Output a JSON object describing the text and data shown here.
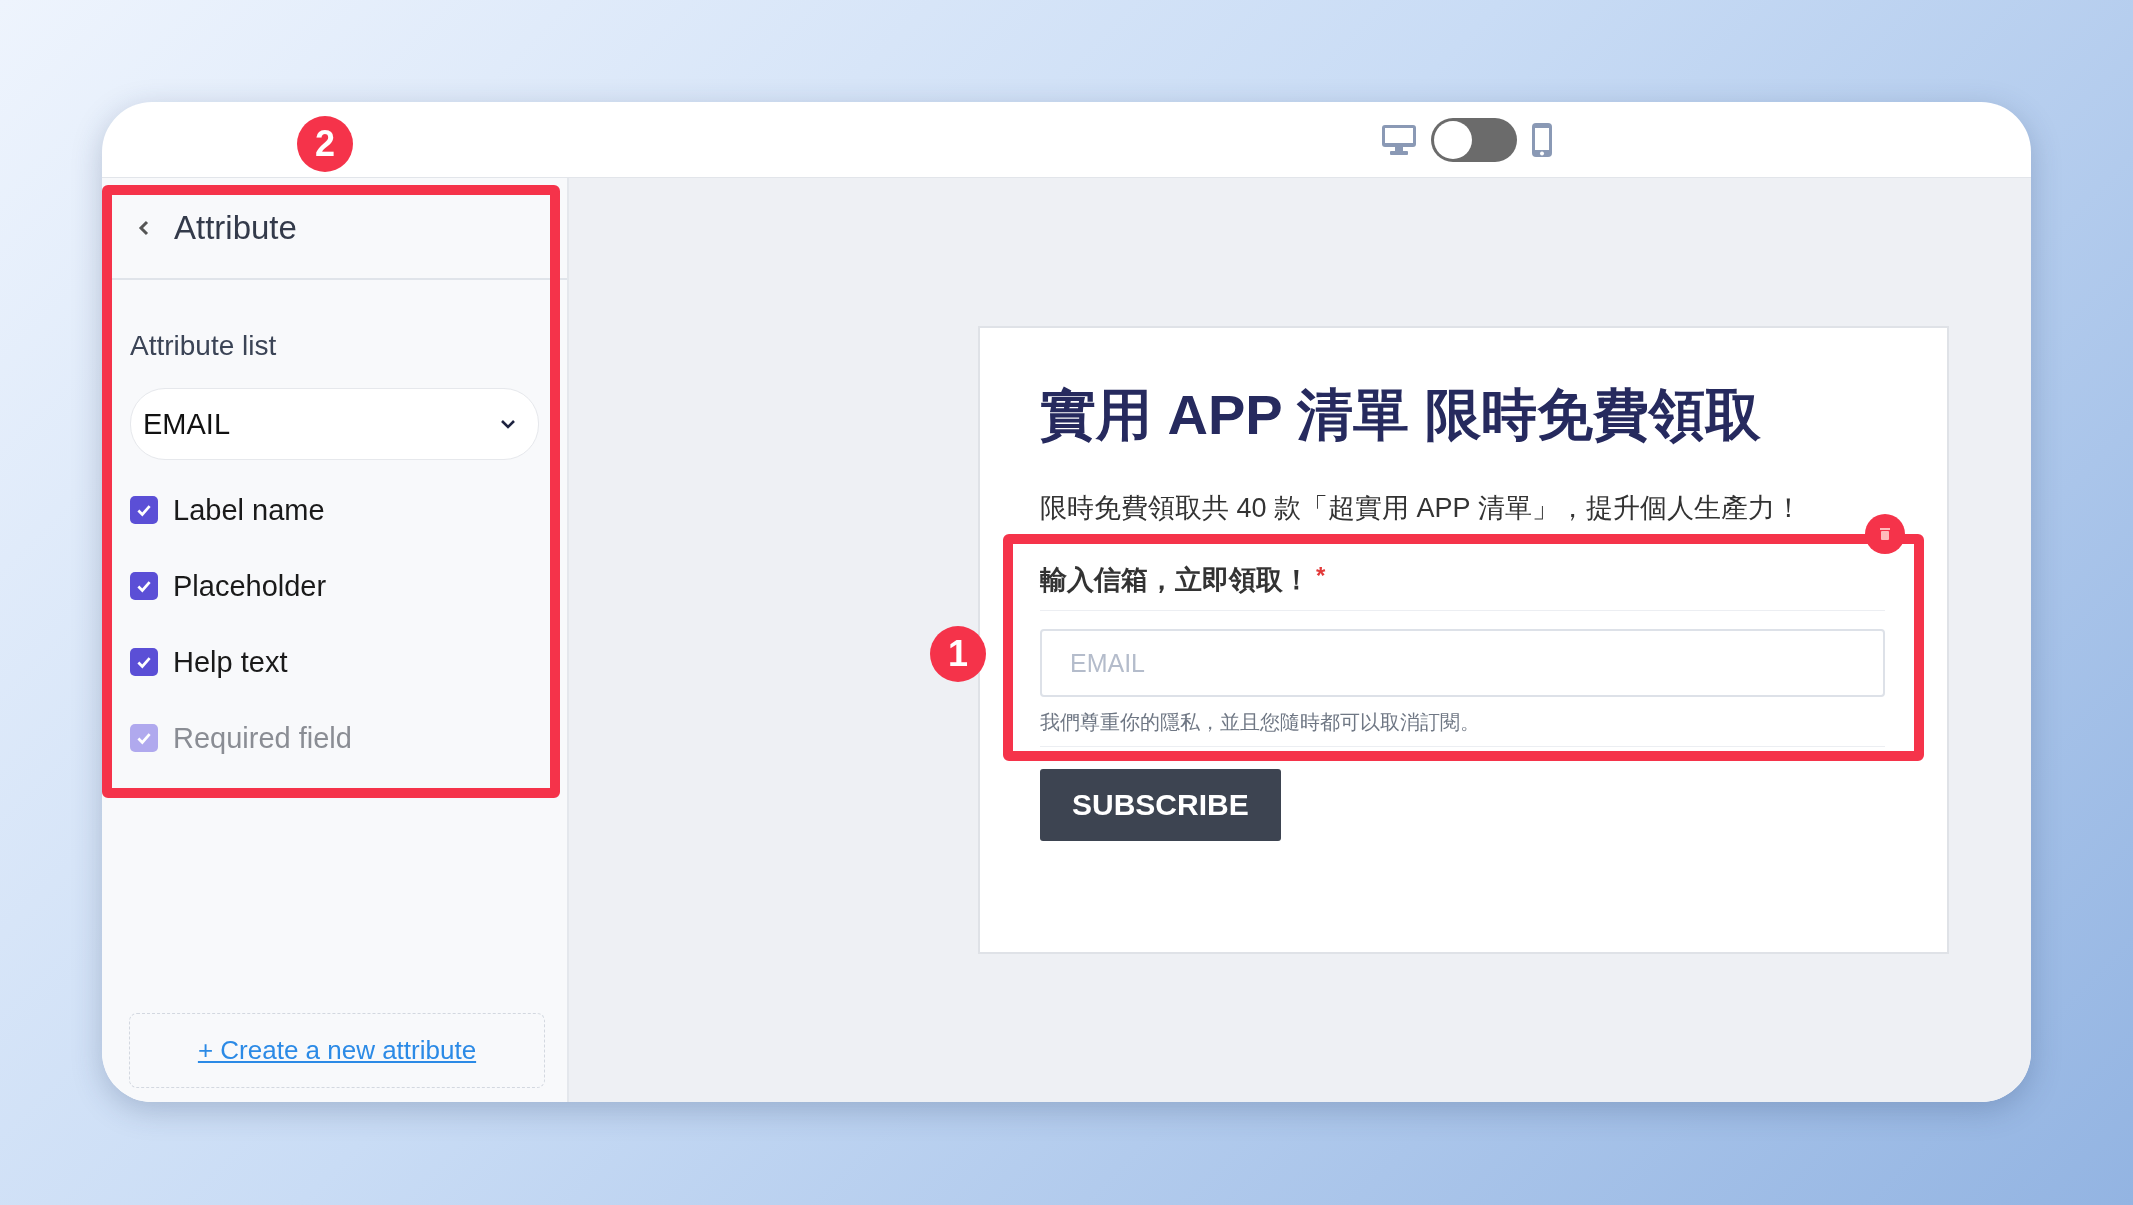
{
  "toolbar": {
    "preview_toggle": {
      "on": false
    }
  },
  "sidebar": {
    "title": "Attribute",
    "list_label": "Attribute list",
    "dropdown": {
      "value": "EMAIL"
    },
    "options": [
      {
        "label": "Label name",
        "checked": true,
        "disabled": false
      },
      {
        "label": "Placeholder",
        "checked": true,
        "disabled": false
      },
      {
        "label": "Help text",
        "checked": true,
        "disabled": false
      },
      {
        "label": "Required field",
        "checked": true,
        "disabled": true
      }
    ],
    "create_link": "+ Create a new attribute",
    "annotation": {
      "badge": "2"
    }
  },
  "form": {
    "title": "實用 APP 清單 限時免費領取",
    "subtitle": "限時免費領取共 40 款「超實用 APP 清單」，提升個人生產力！",
    "field": {
      "label": "輸入信箱，立即領取！",
      "required_mark": "*",
      "placeholder": "EMAIL",
      "help": "我們尊重你的隱私，並且您隨時都可以取消訂閱。"
    },
    "button": "SUBSCRIBE",
    "annotation": {
      "badge": "1"
    }
  }
}
